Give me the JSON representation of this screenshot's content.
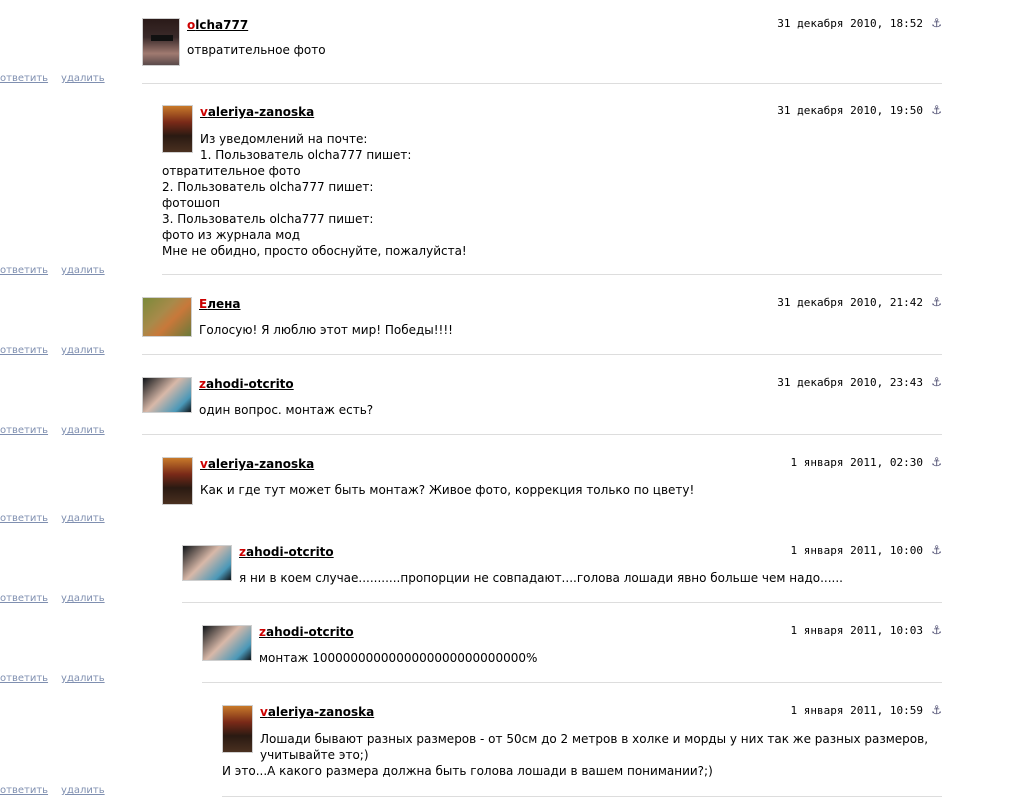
{
  "actions": {
    "reply": "ответить",
    "delete": "удалить"
  },
  "icons": {
    "anchor": "anchor-icon"
  },
  "comments": [
    {
      "user_first": "o",
      "user_rest": "lcha777",
      "date": "31 декабря 2010, 18:52",
      "lines": [
        "отвратительное фото"
      ]
    },
    {
      "user_first": "v",
      "user_rest": "aleriya-zanoska",
      "date": "31 декабря 2010, 19:50",
      "lines": [
        "Из уведомлений на почте:",
        "1. Пользователь olcha777 пишет:",
        "отвратительное фото",
        "2. Пользователь olcha777 пишет:",
        "фотошоп",
        "3. Пользователь olcha777 пишет:",
        "фото из журнала мод",
        "Мне не обидно, просто обоснуйте, пожалуйста!"
      ]
    },
    {
      "user_first": "Е",
      "user_rest": "лена",
      "date": "31 декабря 2010, 21:42",
      "lines": [
        "Голосую! Я люблю этот мир! Победы!!!!"
      ]
    },
    {
      "user_first": "z",
      "user_rest": "ahodi-otcrito",
      "date": "31 декабря 2010, 23:43",
      "lines": [
        "один вопрос. монтаж есть?"
      ]
    },
    {
      "user_first": "v",
      "user_rest": "aleriya-zanoska",
      "date": "1 января 2011, 02:30",
      "lines": [
        "Как и где тут может быть монтаж? Живое фото, коррекция только по цвету!"
      ]
    },
    {
      "user_first": "z",
      "user_rest": "ahodi-otcrito",
      "date": "1 января 2011, 10:00",
      "lines": [
        "я ни в коем случае...........пропорции не совпадают....голова лошади явно больше чем надо......"
      ]
    },
    {
      "user_first": "z",
      "user_rest": "ahodi-otcrito",
      "date": "1 января 2011, 10:03",
      "lines": [
        "монтаж 1000000000000000000000000000%"
      ]
    },
    {
      "user_first": "v",
      "user_rest": "aleriya-zanoska",
      "date": "1 января 2011, 10:59",
      "lines": [
        "Лошади бывают разных размеров - от 50см до 2 метров в холке и морды у них так же разных размеров,",
        "учитывайте это;)",
        "И это...А какого размера должна быть голова лошади в вашем понимании?;)"
      ]
    }
  ]
}
